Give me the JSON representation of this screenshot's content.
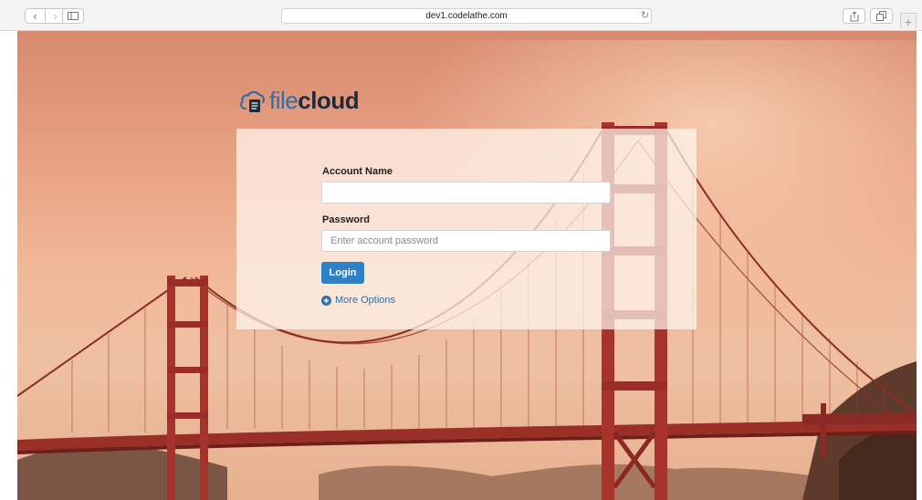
{
  "browser": {
    "url": "dev1.codelathe.com",
    "icons": {
      "back": "chevron-left-icon",
      "forward": "chevron-right-icon",
      "sidebar": "sidebar-icon",
      "reload": "reload-icon",
      "share": "share-icon",
      "tabs": "tabs-overview-icon",
      "new_tab": "plus-icon"
    }
  },
  "logo": {
    "file": "file",
    "cloud": "cloud",
    "icon": "cloud-document-icon"
  },
  "login": {
    "account_label": "Account Name",
    "account_value": "",
    "account_placeholder": "",
    "password_label": "Password",
    "password_placeholder": "Enter account password",
    "login_label": "Login",
    "more_options_label": "More Options",
    "more_options_icon": "plus-circle-icon"
  },
  "colors": {
    "accent": "#2f80c6",
    "logo_blue": "#2f6ea7",
    "logo_dark": "#1f2b3a",
    "bridge_red": "#a8322c"
  }
}
